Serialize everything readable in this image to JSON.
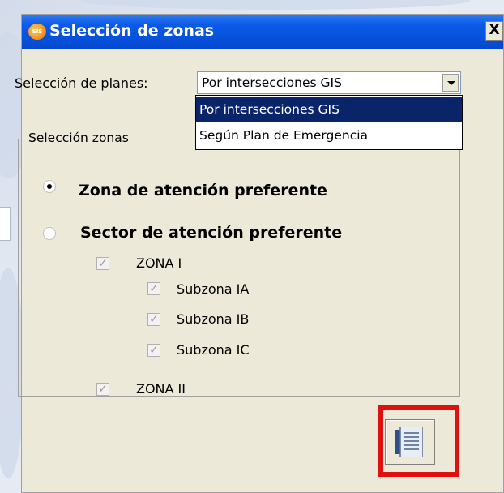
{
  "window": {
    "title": "Selección de zonas",
    "app_icon_text": "SIS",
    "close_label": "X"
  },
  "planes": {
    "label": "Selección de planes:",
    "selected": "Por intersecciones GIS",
    "options": [
      "Por intersecciones GIS",
      "Según Plan de Emergencia"
    ]
  },
  "zonas": {
    "legend": "Selección zonas",
    "radio_zona": "Zona de atención preferente",
    "radio_sector": "Sector de atención preferente",
    "checks": [
      {
        "label": "ZONA I",
        "checked": true
      },
      {
        "label": "Subzona IA",
        "checked": true
      },
      {
        "label": "Subzona IB",
        "checked": true
      },
      {
        "label": "Subzona IC",
        "checked": true
      },
      {
        "label": "ZONA II",
        "checked": true
      }
    ]
  },
  "colors": {
    "titlebar": "#0651dc",
    "selection": "#0a246a",
    "highlight_frame": "#e01010"
  },
  "icons": {
    "app": "app-logo-icon",
    "action": "document-list-icon"
  }
}
